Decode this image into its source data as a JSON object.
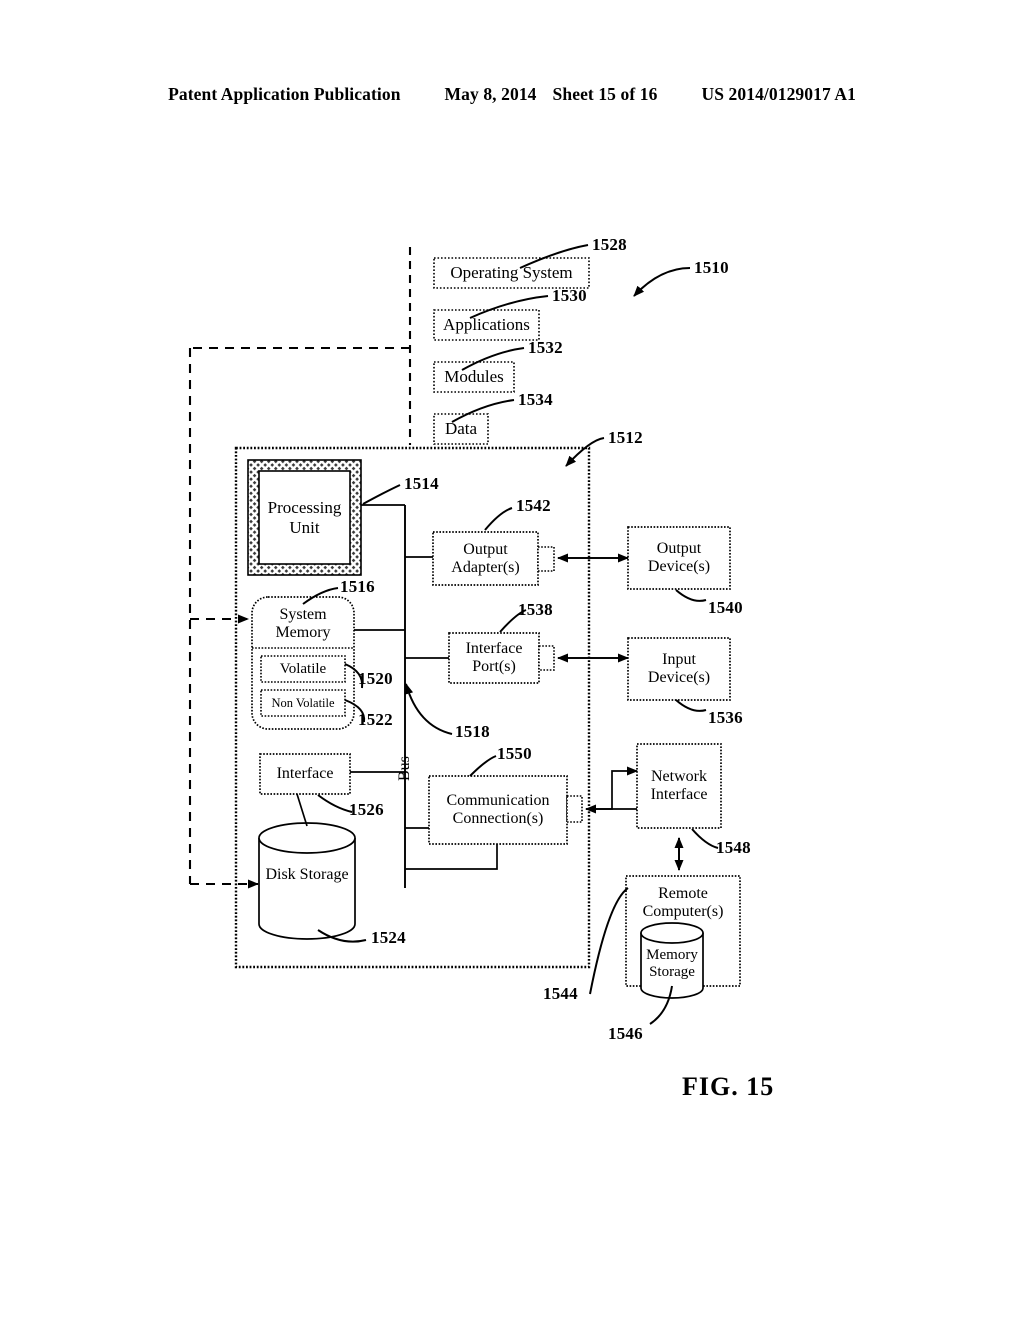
{
  "header": {
    "publication": "Patent Application Publication",
    "date": "May 8, 2014",
    "sheet": "Sheet 15 of 16",
    "patent_number": "US 2014/0129017 A1"
  },
  "figure": {
    "caption": "FIG. 15"
  },
  "software_stack": [
    {
      "label": "Operating System",
      "ref": "1528"
    },
    {
      "label": "Applications",
      "ref": "1530"
    },
    {
      "label": "Modules",
      "ref": "1532"
    },
    {
      "label": "Data",
      "ref": "1534"
    }
  ],
  "nodes": {
    "system": {
      "ref": "1510"
    },
    "computer": {
      "ref": "1512"
    },
    "processing_unit": {
      "label": "Processing\nUnit",
      "line1": "Processing",
      "line2": "Unit",
      "ref": "1514"
    },
    "system_memory": {
      "label": "System\nMemory",
      "line1": "System",
      "line2": "Memory",
      "ref": "1516"
    },
    "volatile": {
      "label": "Volatile",
      "ref": "1520"
    },
    "non_volatile": {
      "label": "Non Volatile",
      "ref": "1522"
    },
    "bus": {
      "label": "Bus",
      "ref": "1518"
    },
    "interface": {
      "label": "Interface",
      "ref": "1526"
    },
    "disk_storage": {
      "label": "Disk Storage",
      "ref": "1524"
    },
    "output_adapters": {
      "line1": "Output",
      "line2": "Adapter(s)",
      "ref": "1542"
    },
    "output_devices": {
      "line1": "Output",
      "line2": "Device(s)",
      "ref": "1540"
    },
    "interface_ports": {
      "line1": "Interface",
      "line2": "Port(s)",
      "ref": "1538"
    },
    "input_devices": {
      "line1": "Input",
      "line2": "Device(s)",
      "ref": "1536"
    },
    "communication_connections": {
      "line1": "Communication",
      "line2": "Connection(s)",
      "ref": "1550"
    },
    "network_interface": {
      "line1": "Network",
      "line2": "Interface",
      "ref": "1548"
    },
    "remote_computers": {
      "line1": "Remote",
      "line2": "Computer(s)",
      "ref": "1544"
    },
    "memory_storage": {
      "line1": "Memory",
      "line2": "Storage",
      "ref": "1546"
    }
  },
  "colors": {
    "ink": "#000000",
    "paper": "#ffffff",
    "hatch": "#555555"
  }
}
